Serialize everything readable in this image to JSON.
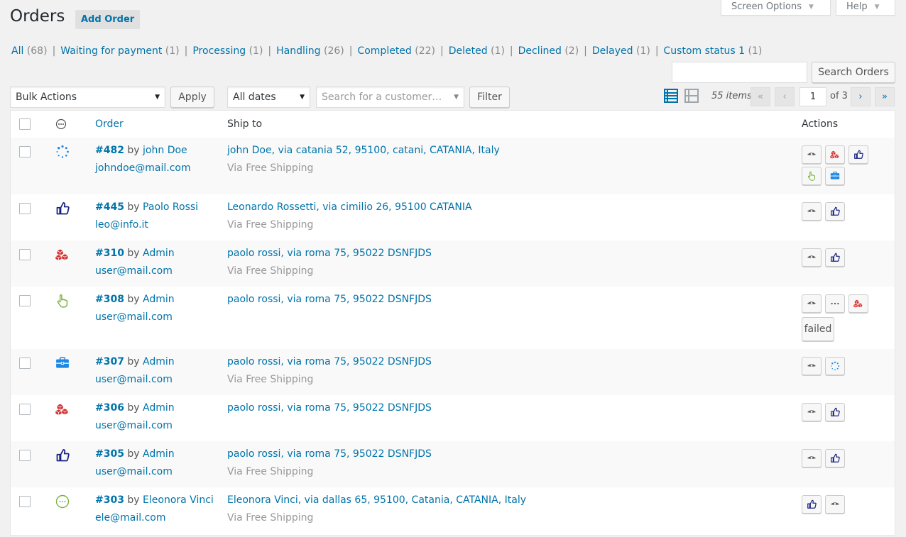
{
  "header": {
    "title": "Orders",
    "add_order": "Add Order",
    "screen_options": "Screen Options",
    "help": "Help"
  },
  "status_links": [
    {
      "label": "All",
      "count": "(68)"
    },
    {
      "label": "Waiting for payment",
      "count": "(1)"
    },
    {
      "label": "Processing",
      "count": "(1)"
    },
    {
      "label": "Handling",
      "count": "(26)"
    },
    {
      "label": "Completed",
      "count": "(22)"
    },
    {
      "label": "Deleted",
      "count": "(1)"
    },
    {
      "label": "Declined",
      "count": "(2)"
    },
    {
      "label": "Delayed",
      "count": "(1)"
    },
    {
      "label": "Custom status 1",
      "count": "(1)"
    }
  ],
  "toolbar": {
    "search_value": "",
    "search_button": "Search Orders",
    "bulk_actions": "Bulk Actions",
    "apply": "Apply",
    "dates": "All dates",
    "customer_placeholder": "Search for a customer…",
    "filter": "Filter",
    "items_count": "55 items",
    "first": "«",
    "prev": "‹",
    "current_page": "1",
    "page_of": "of 3",
    "next": "›",
    "last": "»"
  },
  "table": {
    "columns": {
      "order": "Order",
      "ship_to": "Ship to",
      "actions": "Actions"
    },
    "rows": [
      {
        "number": "#482",
        "by": "by",
        "customer": "john Doe",
        "email": "johndoe@mail.com",
        "ship": "john Doe, via catania 52, 95100, catani, CATANIA, Italy",
        "method": "Via Free Shipping",
        "status_icon": "spinner-icon",
        "actions": [
          "eye-icon",
          "boxes-icon",
          "thumbs-up-icon",
          "hand-pointer-icon",
          "briefcase-icon"
        ]
      },
      {
        "number": "#445",
        "by": "by",
        "customer": "Paolo Rossi",
        "email": "leo@info.it",
        "ship": "Leonardo Rossetti, via cimilio 26, 95100 CATANIA",
        "method": "Via Free Shipping",
        "status_icon": "thumbs-up-icon",
        "actions": [
          "eye-icon",
          "thumbs-up-icon"
        ]
      },
      {
        "number": "#310",
        "by": "by",
        "customer": "Admin",
        "email": "user@mail.com",
        "ship": "paolo rossi, via roma 75, 95022 DSNFJDS",
        "method": "Via Free Shipping",
        "status_icon": "boxes-icon",
        "actions": [
          "eye-icon",
          "thumbs-up-icon"
        ]
      },
      {
        "number": "#308",
        "by": "by",
        "customer": "Admin",
        "email": "user@mail.com",
        "ship": "paolo rossi, via roma 75, 95022 DSNFJDS",
        "method": "",
        "status_icon": "hand-pointer-icon",
        "actions": [
          "eye-icon",
          "ellipsis-icon",
          "boxes-icon"
        ],
        "text_action": "failed"
      },
      {
        "number": "#307",
        "by": "by",
        "customer": "Admin",
        "email": "user@mail.com",
        "ship": "paolo rossi, via roma 75, 95022 DSNFJDS",
        "method": "Via Free Shipping",
        "status_icon": "briefcase-icon",
        "actions": [
          "eye-icon",
          "spinner-icon"
        ]
      },
      {
        "number": "#306",
        "by": "by",
        "customer": "Admin",
        "email": "user@mail.com",
        "ship": "paolo rossi, via roma 75, 95022 DSNFJDS",
        "method": "",
        "status_icon": "boxes-icon",
        "actions": [
          "eye-icon",
          "thumbs-up-icon"
        ]
      },
      {
        "number": "#305",
        "by": "by",
        "customer": "Admin",
        "email": "user@mail.com",
        "ship": "paolo rossi, via roma 75, 95022 DSNFJDS",
        "method": "Via Free Shipping",
        "status_icon": "thumbs-up-icon",
        "actions": [
          "eye-icon",
          "thumbs-up-icon"
        ]
      },
      {
        "number": "#303",
        "by": "by",
        "customer": "Eleonora Vinci",
        "email": "ele@mail.com",
        "ship": "Eleonora Vinci, via dallas 65, 95100, Catania, CATANIA, Italy",
        "method": "Via Free Shipping",
        "status_icon": "ellipsis-circle-icon",
        "actions": [
          "thumbs-up-icon",
          "eye-icon"
        ]
      }
    ]
  },
  "colors": {
    "link": "#0073aa",
    "thumbs_up": "#1a237e",
    "boxes": "#d32f2f",
    "hand": "#7cb342",
    "briefcase": "#1e88e5",
    "spinner": "#1e88e5",
    "ellipsis_circle": "#7cb342"
  }
}
